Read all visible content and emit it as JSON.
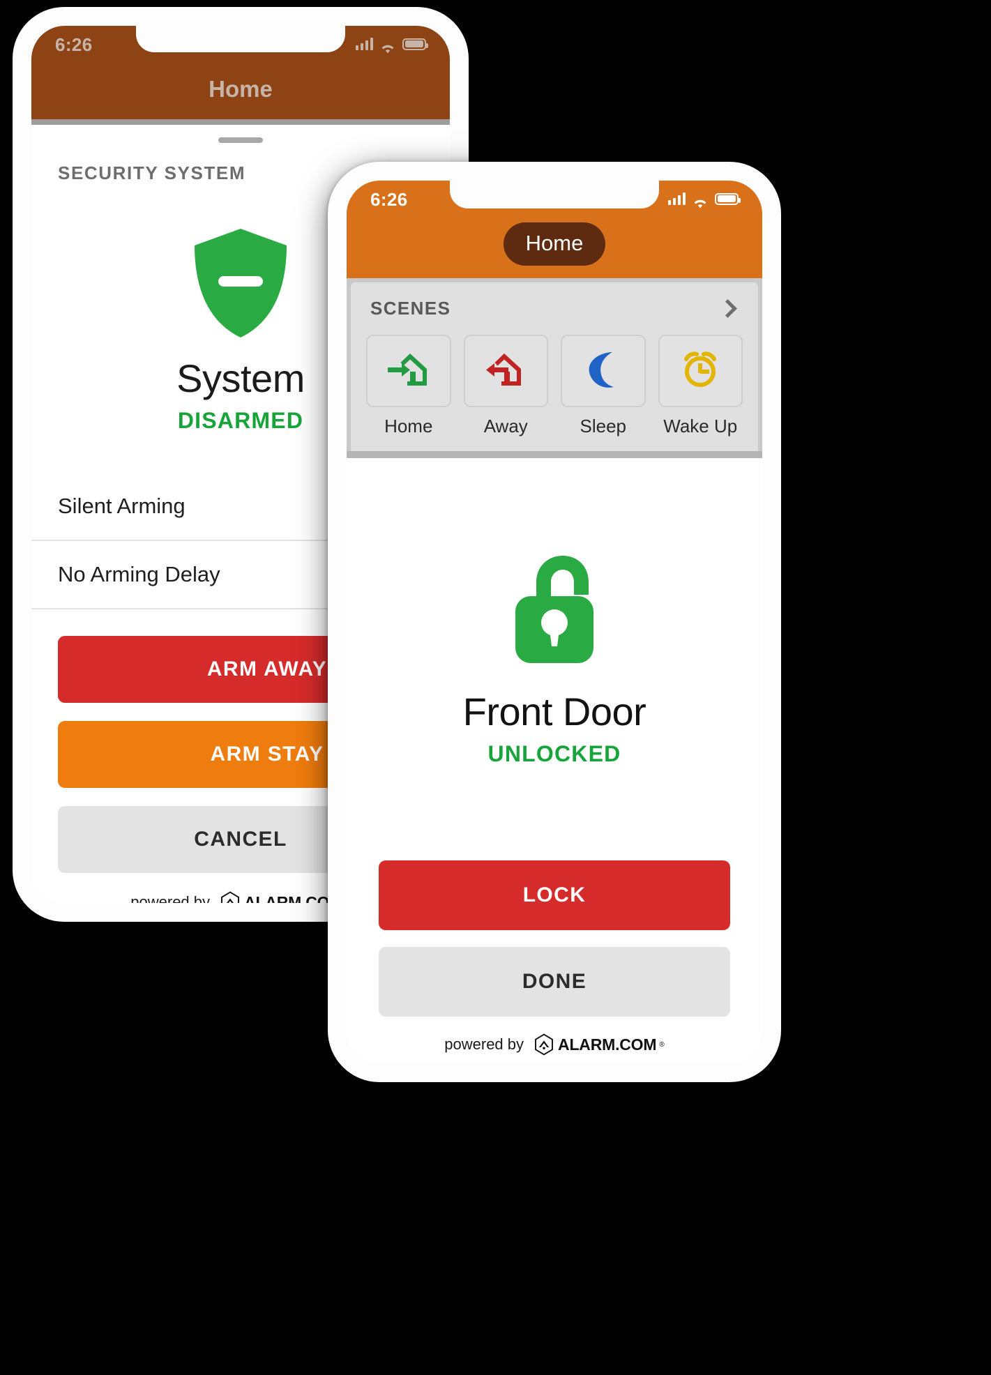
{
  "colors": {
    "phone1_header": "#8e4315",
    "phone2_header": "#d9701a",
    "pill_bg": "#5e2a10",
    "green": "#2aaa43",
    "green_text": "#17a53a",
    "red": "#d52b2b",
    "orange": "#ef7c0e",
    "grey_btn": "#e3e3e3",
    "scene_home": "#249a42",
    "scene_away": "#c32222",
    "scene_sleep": "#2063c6",
    "scene_wake": "#e3b400"
  },
  "phone1": {
    "status_bar": {
      "time": "6:26",
      "cellular_icon": "signal-bars-icon",
      "wifi_icon": "wifi-icon",
      "battery_icon": "battery-icon"
    },
    "nav": {
      "title": "Home"
    },
    "section_label": "SECURITY SYSTEM",
    "chevron_icon": "chevron-right-icon",
    "shield_icon": "shield-disarmed-icon",
    "device_name": "System",
    "device_status": "DISARMED",
    "options": [
      {
        "label": "Silent Arming"
      },
      {
        "label": "No Arming Delay"
      }
    ],
    "buttons": [
      {
        "label": "ARM AWAY",
        "style": "red"
      },
      {
        "label": "ARM STAY",
        "style": "orange"
      },
      {
        "label": "CANCEL",
        "style": "grey"
      }
    ],
    "footer": {
      "powered_by": "powered by",
      "brand": "ALARM.COM",
      "brand_mark": "alarm-hexagon-logo-icon",
      "registered": "®"
    }
  },
  "phone2": {
    "status_bar": {
      "time": "6:26",
      "cellular_icon": "signal-bars-icon",
      "wifi_icon": "wifi-icon",
      "battery_icon": "battery-icon"
    },
    "nav": {
      "pill_label": "Home"
    },
    "scenes": {
      "label": "SCENES",
      "chevron_icon": "chevron-right-icon",
      "items": [
        {
          "label": "Home",
          "icon": "arrow-into-house-icon",
          "color": "#249a42"
        },
        {
          "label": "Away",
          "icon": "arrow-out-of-house-icon",
          "color": "#c32222"
        },
        {
          "label": "Sleep",
          "icon": "crescent-moon-icon",
          "color": "#2063c6"
        },
        {
          "label": "Wake Up",
          "icon": "alarm-clock-icon",
          "color": "#e3b400"
        }
      ]
    },
    "lock_icon": "padlock-open-icon",
    "device_name": "Front Door",
    "device_status": "UNLOCKED",
    "buttons": [
      {
        "label": "LOCK",
        "style": "red"
      },
      {
        "label": "DONE",
        "style": "grey"
      }
    ],
    "footer": {
      "powered_by": "powered by",
      "brand": "ALARM.COM",
      "brand_mark": "alarm-hexagon-logo-icon",
      "registered": "®"
    }
  }
}
